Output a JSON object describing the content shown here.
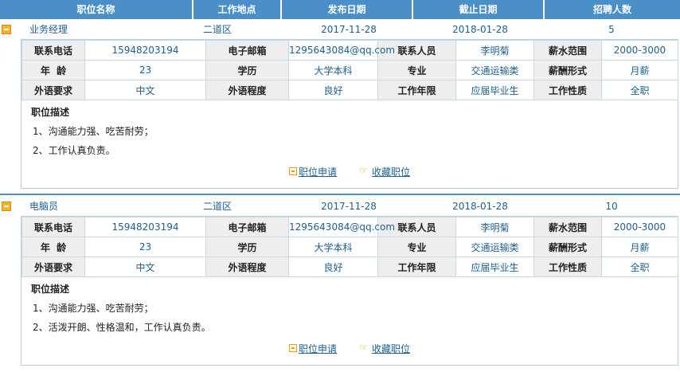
{
  "header": {
    "col_name": "职位名称",
    "col_location": "工作地点",
    "col_posted": "发布日期",
    "col_deadline": "截止日期",
    "col_count": "招聘人数"
  },
  "labels": {
    "phone": "联系电话",
    "email": "电子邮箱",
    "contact": "联系人员",
    "salary": "薪水范围",
    "age": "年  龄",
    "education": "学历",
    "major": "专业",
    "pay_type": "薪酬形式",
    "language": "外语要求",
    "language_level": "外语程度",
    "experience": "工作年限",
    "job_type": "工作性质",
    "description": "职位描述",
    "apply": "职位申请",
    "favorite": "收藏职位"
  },
  "jobs": [
    {
      "name": "业务经理",
      "location": "二道区",
      "posted": "2017-11-28",
      "deadline": "2018-01-28",
      "count": "5",
      "phone": "15948203194",
      "email": "1295643084@qq.com",
      "contact": "李明菊",
      "salary": "2000-3000",
      "age": "23",
      "education": "大学本科",
      "major": "交通运输类",
      "pay_type": "月薪",
      "language": "中文",
      "language_level": "良好",
      "experience": "应届毕业生",
      "job_type": "全职",
      "desc_lines": [
        "1、沟通能力强、吃苦耐劳；",
        "2、工作认真负责。"
      ]
    },
    {
      "name": "电脑员",
      "location": "二道区",
      "posted": "2017-11-28",
      "deadline": "2018-01-28",
      "count": "10",
      "phone": "15948203194",
      "email": "1295643084@qq.com",
      "contact": "李明菊",
      "salary": "2000-3000",
      "age": "23",
      "education": "大学本科",
      "major": "交通运输类",
      "pay_type": "月薪",
      "language": "中文",
      "language_level": "良好",
      "experience": "应届毕业生",
      "job_type": "全职",
      "desc_lines": [
        "1、沟通能力强、吃苦耐劳；",
        "2、活泼开朗、性格温和，工作认真负责。"
      ]
    }
  ],
  "colors": {
    "header_bg": "#4a8fc8",
    "link": "#1f5f8e",
    "label_bg": "#eeeeee",
    "toggle": "#f7b225"
  },
  "icons": {
    "toggle": "collapse-icon",
    "apply": "apply-icon",
    "favorite": "hand-pointer-icon"
  }
}
